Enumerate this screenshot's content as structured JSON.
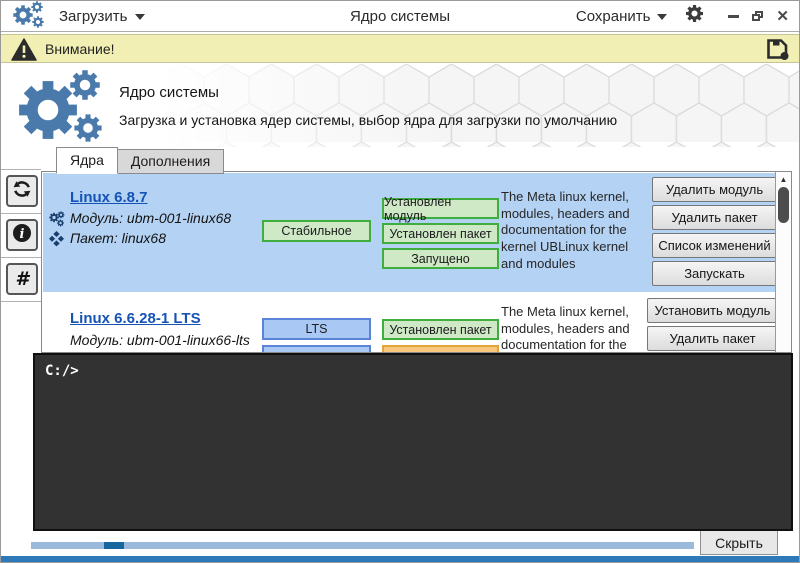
{
  "titlebar": {
    "title": "Ядро системы",
    "load_label": "Загрузить",
    "save_label": "Сохранить"
  },
  "warning_bar": {
    "label": "Внимание!"
  },
  "header": {
    "title": "Ядро системы",
    "subtitle": "Загрузка и установка ядер системы, выбор ядра для загрузки по умолчанию"
  },
  "tabs": {
    "kernels": "Ядра",
    "addons": "Дополнения"
  },
  "sidebar": {
    "hash_glyph": "#"
  },
  "kernels": [
    {
      "name": "Linux 6.8.7",
      "module_label": "Модуль:",
      "module_value": "ubm-001-linux68",
      "package_label": "Пакет:",
      "package_value": "linux68",
      "channel_badge": "Стабильное",
      "status_badges": [
        "Установлен модуль",
        "Установлен пакет",
        "Запущено"
      ],
      "description": "The Meta linux kernel, modules, headers and documentation for the kernel UBLinux kernel and modules",
      "buttons": [
        "Удалить модуль",
        "Удалить пакет",
        "Список изменений",
        "Запускать"
      ],
      "selected": true
    },
    {
      "name": "Linux 6.6.28-1 LTS",
      "module_label": "Модуль:",
      "module_value": "ubm-001-linux66-lts",
      "channel_badge": "LTS",
      "status_badges": [
        "Установлен пакет"
      ],
      "description": "The Meta linux kernel, modules, headers and documentation for the",
      "buttons": [
        "Установить модуль",
        "Удалить пакет"
      ],
      "selected": false
    }
  ],
  "terminal": {
    "prompt": "C:/>"
  },
  "footer": {
    "hide_label": "Скрыть"
  },
  "colors": {
    "accent_blue": "#2e7ab8",
    "selection_blue": "#b4d2f3",
    "badge_green_bg": "#cfe8c6",
    "badge_green_border": "#3fae3f",
    "badge_blue_bg": "#a9c9f4",
    "badge_blue_border": "#5b83d8",
    "badge_orange_bg": "#f7c77d",
    "badge_orange_border": "#e2a43c",
    "warning_bg": "#f1efb4",
    "logo_blue": "#4a7aab",
    "progress_track": "#9bb9da",
    "progress_chunk": "#17679f"
  }
}
